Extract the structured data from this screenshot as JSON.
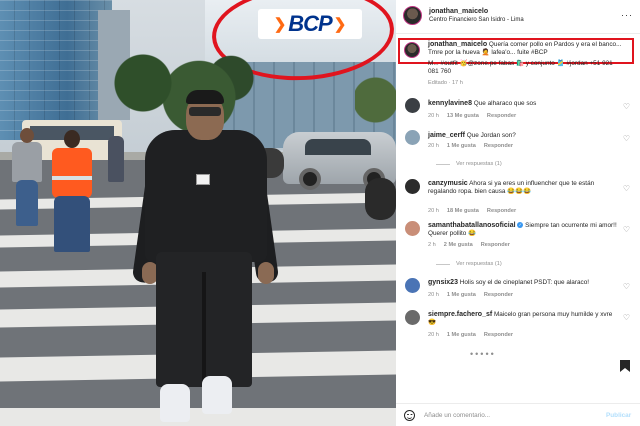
{
  "photo": {
    "sign_text": "BCP",
    "highlight_color": "#e0141e"
  },
  "post": {
    "username": "jonathan_maicelo",
    "location": "Centro Financiero San Isidro - Lima",
    "caption_username": "jonathan_maicelo",
    "caption_line1": "Quería comer pollo en Pardos y era el banco...",
    "caption_line2": "Tmre por la hueva 🤦 lafea'o... fuite #BCP",
    "caption_cont1": "M... #outfit 🥳@zone.pe fabas 🛍️ y conjunto 🎽 #jordan +51 921",
    "caption_cont2": "081 760",
    "edited": "Editado · 17 h"
  },
  "comments": [
    {
      "username": "kennylavine8",
      "text": "Que alharaco que sos",
      "time": "20 h",
      "likes": "13 Me gusta",
      "reply": "Responder",
      "avatar_color": "#3b3f44"
    },
    {
      "username": "jaime_cerff",
      "text": "Que Jordan son?",
      "time": "20 h",
      "likes": "1 Me gusta",
      "reply": "Responder",
      "avatar_color": "#8aa3b6",
      "view_replies": "Ver respuestas (1)"
    },
    {
      "username": "canzymusic",
      "text": "Ahora si ya eres un influencher que te están regalando ropa. bien causa 😂😂😂",
      "time": "20 h",
      "likes": "18 Me gusta",
      "reply": "Responder",
      "avatar_color": "#2c2c2c"
    },
    {
      "username": "samanthabatallanosoficial",
      "text": "Siempre tan ocurrente mi amor!! Querer pollito 😂",
      "time": "2 h",
      "likes": "2 Me gusta",
      "reply": "Responder",
      "avatar_color": "#c98e78",
      "view_replies": "Ver respuestas (1)"
    },
    {
      "username": "gynsix23",
      "text": "Holis soy el de cineplanet PSDT: que alaraco!",
      "time": "20 h",
      "likes": "1 Me gusta",
      "reply": "Responder",
      "avatar_color": "#4a74b5"
    },
    {
      "username": "siempre.fachero_sf",
      "text": "Maicelo gran persona muy humilde y xvre 😎",
      "time": "20 h",
      "likes": "1 Me gusta",
      "reply": "Responder",
      "avatar_color": "#6a6a6a"
    }
  ],
  "footer": {
    "placeholder": "Añade un comentario...",
    "post_label": "Publicar"
  }
}
